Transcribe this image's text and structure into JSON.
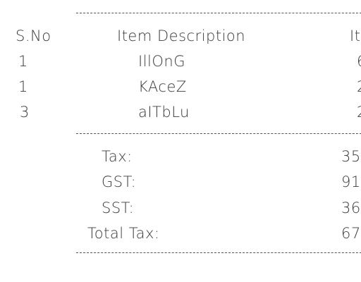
{
  "table": {
    "headers": {
      "sno": "S.No",
      "description": "Item Description",
      "item_col": "It"
    },
    "rows": [
      {
        "sno": "1",
        "description": "IllOnG",
        "value": "6"
      },
      {
        "sno": "1",
        "description": "KAceZ",
        "value": "2"
      },
      {
        "sno": "3",
        "description": "aITbLu",
        "value": "2"
      }
    ]
  },
  "summary": [
    {
      "label": "Tax:",
      "value": "35"
    },
    {
      "label": "GST:",
      "value": "91."
    },
    {
      "label": "SST:",
      "value": "36"
    },
    {
      "label": "Total Tax:",
      "value": "67"
    }
  ]
}
